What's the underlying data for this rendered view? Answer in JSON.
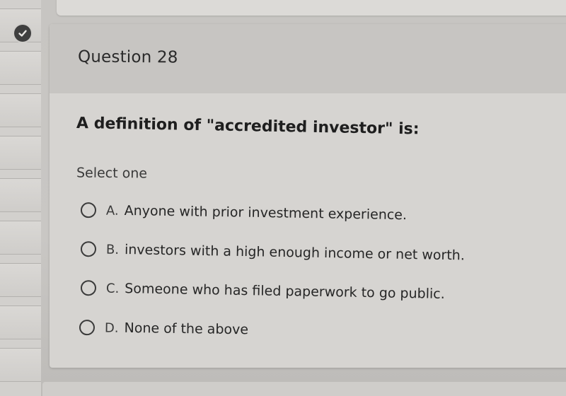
{
  "question": {
    "number_label": "Question 28",
    "text": "A definition of \"accredited investor\" is:",
    "instruction": "Select one",
    "options": [
      {
        "letter": "A.",
        "text": "Anyone with prior investment experience.",
        "selected": false
      },
      {
        "letter": "B.",
        "text": "investors with a high enough income or net worth.",
        "selected": false
      },
      {
        "letter": "C.",
        "text": "Someone who has filed paperwork to go public.",
        "selected": false
      },
      {
        "letter": "D.",
        "text": "None of the above",
        "selected": false
      }
    ]
  },
  "status": {
    "answered_icon": "check-icon",
    "accent_color": "#3f3f3f"
  }
}
